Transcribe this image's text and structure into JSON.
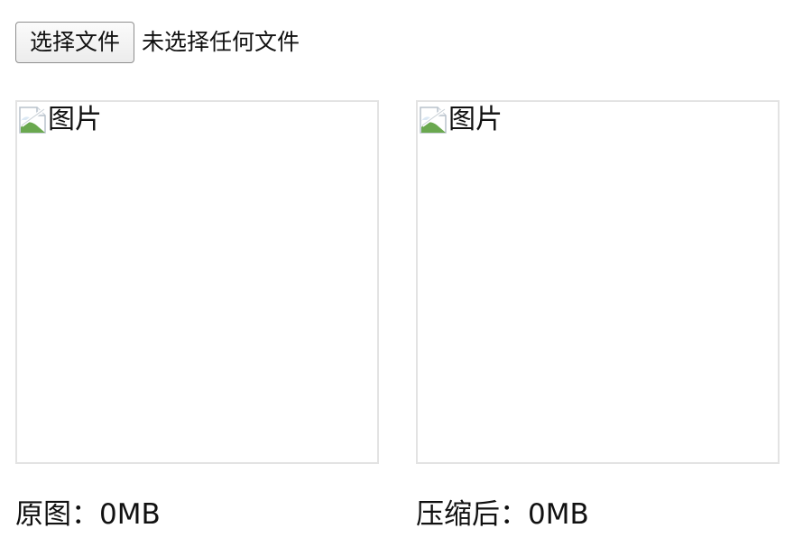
{
  "file_input": {
    "button_label": "选择文件",
    "status_text": "未选择任何文件"
  },
  "images": [
    {
      "alt": "图片",
      "icon": "broken-image-icon"
    },
    {
      "alt": "图片",
      "icon": "broken-image-icon"
    }
  ],
  "sizes": {
    "original_label": "原图：",
    "original_value": "0MB",
    "compressed_label": "压缩后：",
    "compressed_value": "0MB"
  },
  "colors": {
    "card_border": "#e3e3e3",
    "button_border": "#8f8f8f",
    "placeholder_green": "#6aa84f",
    "placeholder_sky": "#dbe8f4"
  }
}
